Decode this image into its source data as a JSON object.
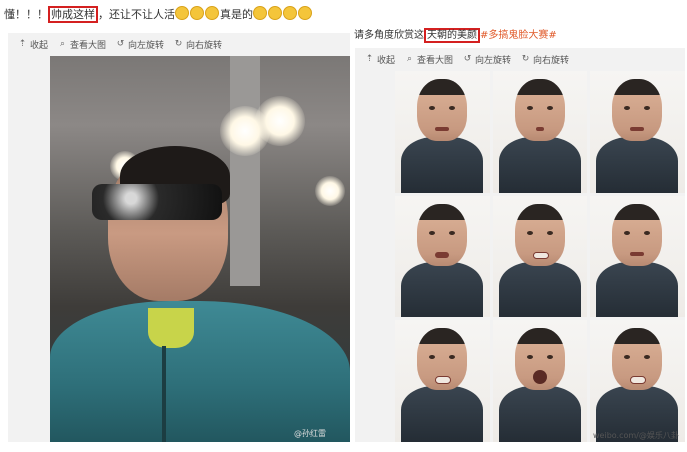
{
  "top_left": {
    "prefix": "懂！！！",
    "highlight": "帅成这样",
    "middle": "，还让不让人活",
    "suffix": "真是的",
    "emoji_count_a": 3,
    "emoji_count_b": 4
  },
  "top_right": {
    "prefix": "请多角度欣赏这",
    "highlight": "天朝的美颜",
    "hashtag": "#多搞鬼脸大赛#"
  },
  "toolbar": {
    "collapse": "收起",
    "view_large": "查看大图",
    "rotate_left": "向左旋转",
    "rotate_right": "向右旋转"
  },
  "left_photo": {
    "watermark": "@孙红雷"
  },
  "right_photo": {
    "cells": [
      "",
      "",
      "",
      "",
      "",
      "",
      "",
      "",
      ""
    ],
    "credit_site": "weibo.com/",
    "credit_user": "@娱乐八卦"
  },
  "colors": {
    "highlight_border": "#d42020",
    "hashtag": "#e05a2a",
    "panel_bg": "#f2f2f2"
  },
  "icons": [
    "collapse-arrow-icon",
    "magnifier-icon",
    "rotate-left-icon",
    "rotate-right-icon",
    "emoji-icon"
  ]
}
